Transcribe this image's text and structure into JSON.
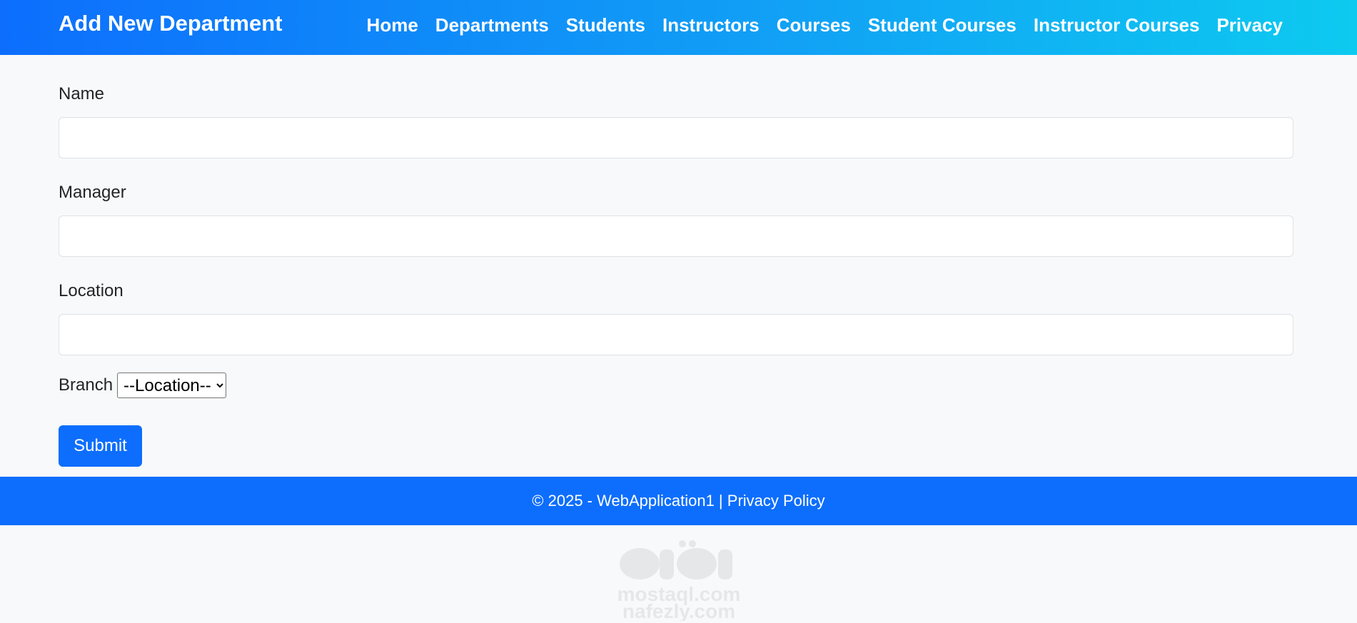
{
  "header": {
    "brand": "Add New Department",
    "nav": [
      {
        "label": "Home"
      },
      {
        "label": "Departments"
      },
      {
        "label": "Students"
      },
      {
        "label": "Instructors"
      },
      {
        "label": "Courses"
      },
      {
        "label": "Student Courses"
      },
      {
        "label": "Instructor Courses"
      },
      {
        "label": "Privacy"
      }
    ]
  },
  "form": {
    "name_label": "Name",
    "name_value": "",
    "manager_label": "Manager",
    "manager_value": "",
    "location_label": "Location",
    "location_value": "",
    "branch_label": "Branch",
    "branch_selected": "--Location--",
    "submit_label": "Submit"
  },
  "footer": {
    "text": "© 2025 - WebApplication1 | ",
    "link": "Privacy Policy"
  },
  "watermark": {
    "line1": "mostaql.com",
    "line2": "nafezly.com"
  },
  "colors": {
    "primary": "#0d6efd",
    "header_gradient_end": "#0dcaf0",
    "background": "#f8f9fa"
  }
}
